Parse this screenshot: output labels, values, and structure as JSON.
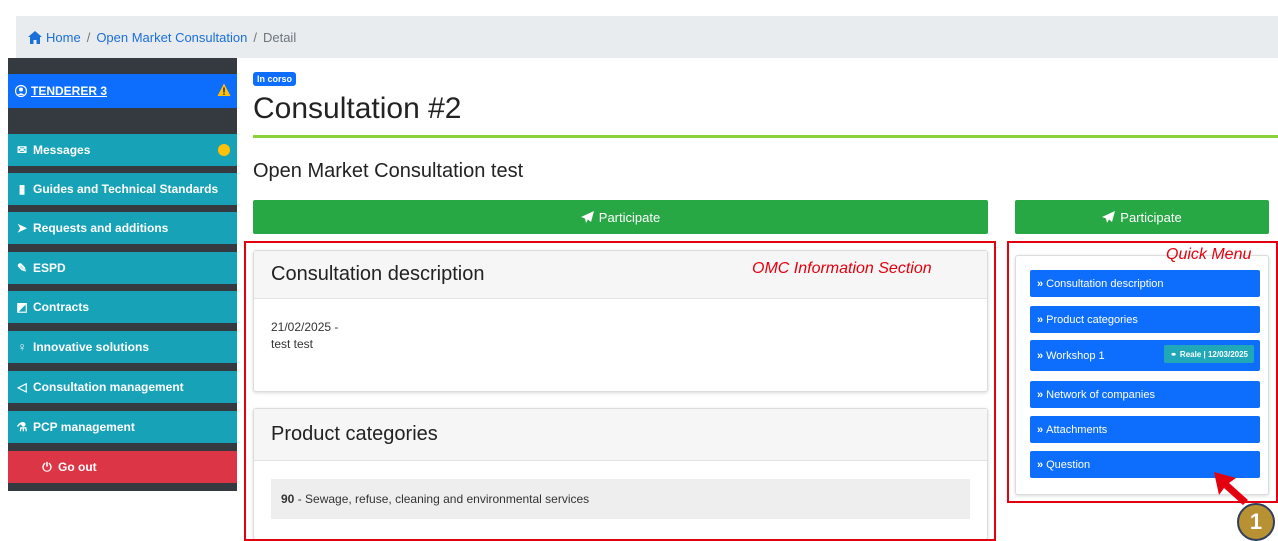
{
  "breadcrumb": {
    "home": "Home",
    "omc": "Open Market Consultation",
    "current": "Detail",
    "sep": "/"
  },
  "sidebar": {
    "user": "TENDERER 3",
    "items": [
      {
        "label": "Messages",
        "icon": "envelope-icon"
      },
      {
        "label": "Guides and Technical Standards",
        "icon": "file-icon"
      },
      {
        "label": "Requests and additions",
        "icon": "paper-plane-icon"
      },
      {
        "label": "ESPD",
        "icon": "edit-icon"
      },
      {
        "label": "Contracts",
        "icon": "contract-icon"
      },
      {
        "label": "Innovative solutions",
        "icon": "lightbulb-icon"
      },
      {
        "label": "Consultation management",
        "icon": "megaphone-icon"
      },
      {
        "label": "PCP management",
        "icon": "flask-icon"
      }
    ],
    "go_out": "Go out"
  },
  "header": {
    "status_badge": "In corso",
    "title": "Consultation #2",
    "subtitle": "Open Market Consultation test"
  },
  "actions": {
    "participate": "Participate"
  },
  "annotations": {
    "info_section": "OMC Information Section",
    "quick_menu": "Quick Menu",
    "step": "1"
  },
  "description_card": {
    "heading": "Consultation description",
    "date_line": "21/02/2025 -",
    "text": "test test"
  },
  "categories_card": {
    "heading": "Product categories",
    "code": "90",
    "label": " - Sewage, refuse, cleaning and environmental services"
  },
  "quick_menu": {
    "items": [
      {
        "label": "Consultation description"
      },
      {
        "label": "Product categories"
      },
      {
        "label": "Workshop 1",
        "badge": "Reale | 12/03/2025"
      },
      {
        "label": "Network of companies"
      },
      {
        "label": "Attachments"
      },
      {
        "label": "Question"
      }
    ]
  },
  "colors": {
    "primary": "#0d6efd",
    "sidebar_item": "#17a2b8",
    "success": "#28a745",
    "danger": "#dc3545",
    "annotation": "#e3000f",
    "title_underline": "#8bd13a"
  }
}
